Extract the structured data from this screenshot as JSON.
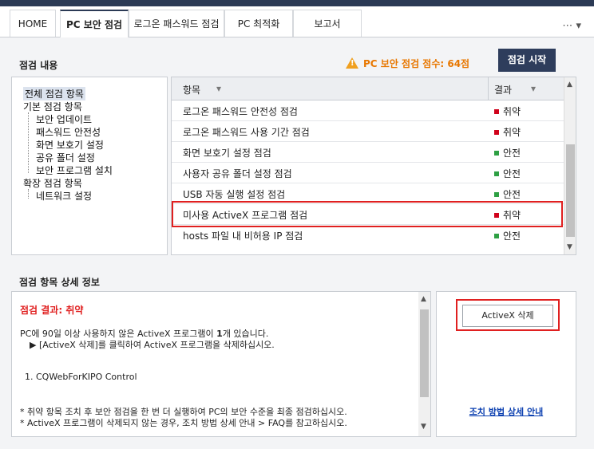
{
  "tabs": [
    {
      "label": "HOME"
    },
    {
      "label": "PC 보안 점검"
    },
    {
      "label": "로그온 패스워드 점검"
    },
    {
      "label": "PC 최적화"
    },
    {
      "label": "보고서"
    }
  ],
  "more_label": "⋯ ▾",
  "check": {
    "title": "점검 내용",
    "score_label": "PC 보안 점검 점수: 64점",
    "start_button": "점검 시작"
  },
  "tree": {
    "all": "전체 점검 항목",
    "basic": "기본 점검 항목",
    "basic_items": [
      "보안 업데이트",
      "패스워드 안전성",
      "화면 보호기 설정",
      "공유 폴더 설정",
      "보안 프로그램 설치"
    ],
    "ext": "확장 점검 항목",
    "ext_items": [
      "네트워크 설정"
    ]
  },
  "grid": {
    "col_item": "항목",
    "col_result": "결과",
    "sort_icon": "▾",
    "rows": [
      {
        "name": "로그온 패스워드 안전성 점검",
        "result": "취약",
        "status": "bad"
      },
      {
        "name": "로그온 패스워드 사용 기간 점검",
        "result": "취약",
        "status": "bad"
      },
      {
        "name": "화면 보호기 설정 점검",
        "result": "안전",
        "status": "good"
      },
      {
        "name": "사용자 공유 폴더 설정 점검",
        "result": "안전",
        "status": "good"
      },
      {
        "name": "USB 자동 실행 설정 점검",
        "result": "안전",
        "status": "good"
      },
      {
        "name": "미사용 ActiveX 프로그램 점검",
        "result": "취약",
        "status": "bad"
      },
      {
        "name": "hosts 파일 내 비허용 IP 점검",
        "result": "안전",
        "status": "good"
      }
    ]
  },
  "colors": {
    "bad": "#d0021b",
    "good": "#2ea043",
    "accent": "#2e3d5c",
    "highlight": "#e02020"
  },
  "detail": {
    "title": "점검 항목 상세 정보",
    "result": "점검 결과: 취약",
    "line1_a": "PC에 90일 이상 사용하지 않은 ActiveX 프로그램이 ",
    "line1_count": "1",
    "line1_b": "개 있습니다.",
    "line2": "▶ [ActiveX 삭제]를 클릭하여 ActiveX 프로그램을 삭제하십시오.",
    "program": "1. CQWebForKIPO Control",
    "note1": "* 취약 항목 조치 후 보안 점검을 한 번 더 실행하여 PC의 보안 수준을 최종 점검하십시오.",
    "note2": "* ActiveX 프로그램이 삭제되지 않는 경우, 조치 방법 상세 안내 > FAQ를 참고하십시오.",
    "delete_button": "ActiveX 삭제",
    "guide_link": "조치 방법 상세 안내"
  }
}
